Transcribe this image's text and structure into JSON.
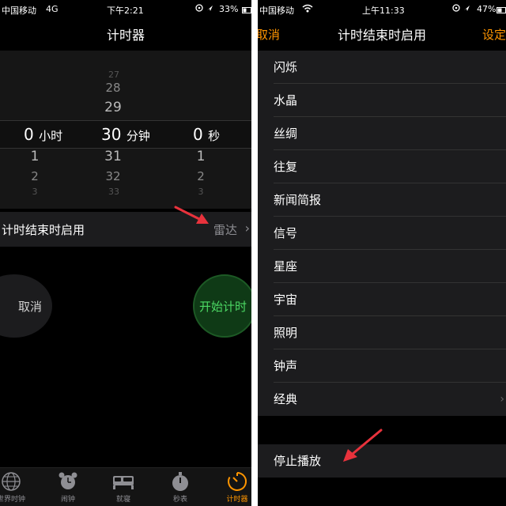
{
  "left_screen": {
    "status": {
      "carrier": "中国移动",
      "network": "4G",
      "time": "下午2:21",
      "battery": "33%"
    },
    "title": "计时器",
    "picker": {
      "hours": {
        "above": [],
        "selected": "0",
        "unit": "小时",
        "below": [
          "1",
          "2",
          "3"
        ]
      },
      "minutes": {
        "above": [
          "27",
          "28",
          "29"
        ],
        "selected": "30",
        "unit": "分钟",
        "below": [
          "31",
          "32",
          "33"
        ]
      },
      "seconds": {
        "above": [],
        "selected": "0",
        "unit": "秒",
        "below": [
          "1",
          "2",
          "3"
        ]
      }
    },
    "when_done": {
      "label": "计时结束时启用",
      "value": "雷达",
      "chevron": "›"
    },
    "cancel_label": "取消",
    "start_label": "开始计时",
    "tabs": [
      {
        "label": "世界时钟",
        "icon": "globe-icon"
      },
      {
        "label": "闹钟",
        "icon": "alarm-clock-icon"
      },
      {
        "label": "就寝",
        "icon": "bed-icon"
      },
      {
        "label": "秒表",
        "icon": "stopwatch-icon"
      },
      {
        "label": "计时器",
        "icon": "timer-icon",
        "active": true
      }
    ],
    "tab_active_color": "#ff9500"
  },
  "right_screen": {
    "status": {
      "carrier": "中国移动",
      "time": "上午11:33",
      "battery": "47%"
    },
    "title": "计时结束时启用",
    "left_button": "取消",
    "right_button": "设定",
    "sounds": [
      "闪烁",
      "水晶",
      "丝绸",
      "往复",
      "新闻简报",
      "信号",
      "星座",
      "宇宙",
      "照明",
      "钟声",
      "经典"
    ],
    "classic_chevron": "›",
    "stop_label": "停止播放"
  },
  "colors": {
    "accent": "#ff9500",
    "start_green": "#4cd964",
    "annotation_arrow": "#e8323c"
  }
}
